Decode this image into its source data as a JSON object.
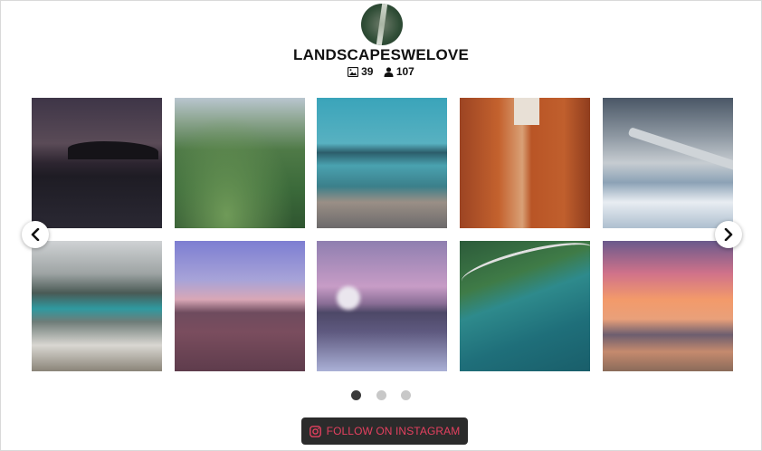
{
  "profile": {
    "username": "LANDSCAPESWELOVE",
    "posts_count": "39",
    "followers_count": "107"
  },
  "gallery": {
    "photos": [
      {
        "label": "dusk-coast"
      },
      {
        "label": "green-valley"
      },
      {
        "label": "harbor-city"
      },
      {
        "label": "red-canyon"
      },
      {
        "label": "airplane-wing"
      },
      {
        "label": "crater-lake"
      },
      {
        "label": "purple-hills"
      },
      {
        "label": "volcano-clouds"
      },
      {
        "label": "aerial-coast"
      },
      {
        "label": "sunset-beach"
      }
    ],
    "current_page": 1,
    "total_pages": 3
  },
  "follow_button": {
    "label": "FOLLOW ON INSTAGRAM"
  },
  "colors": {
    "accent": "#e4405f",
    "button_bg": "#2b2b2b",
    "dot_active": "#3a3a3a",
    "dot_inactive": "#c8c8c8"
  }
}
